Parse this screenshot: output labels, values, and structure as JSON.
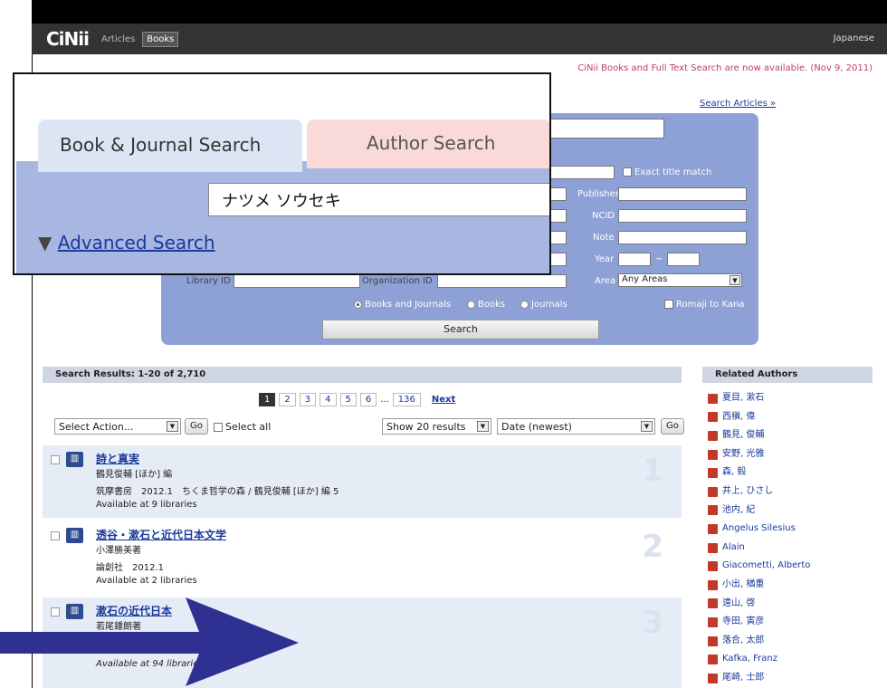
{
  "header": {
    "logo": "CiNii",
    "nav_articles": "Articles",
    "nav_books": "Books",
    "language": "Japanese"
  },
  "notice": "CiNii Books and Full Text Search are now available. (Nov 9, 2011)",
  "search_articles_link": "Search Articles »",
  "overlay": {
    "tab_book": "Book & Journal Search",
    "tab_author": "Author Search",
    "query_value": "ナツメ ソウセキ",
    "advanced_arrow": "▼",
    "advanced_label": "Advanced Search"
  },
  "form": {
    "exact_title": "Exact title match",
    "publisher": "Publisher",
    "ncid": "NCID",
    "note": "Note",
    "year": "Year",
    "year_sep": "~",
    "library_id": "Library ID",
    "organization_id": "Organization ID",
    "area": "Area",
    "area_value": "Any Areas",
    "radio_both": "Books and Journals",
    "radio_books": "Books",
    "radio_journals": "Journals",
    "romaji": "Romaji to Kana",
    "search_button": "Search"
  },
  "results": {
    "header": "Search Results: 1-20 of 2,710",
    "pages": [
      "1",
      "2",
      "3",
      "4",
      "5",
      "6"
    ],
    "ellipsis": "...",
    "last_page": "136",
    "next": "Next",
    "select_action": "Select Action...",
    "go": "Go",
    "select_all": "Select all",
    "show_results": "Show 20 results",
    "sort": "Date (newest)",
    "items": [
      {
        "title": "詩と真実",
        "author": "鶴見俊輔 [ほか] 編",
        "pub": "筑摩書房　2012.1　ちくま哲学の森 / 鶴見俊輔 [ほか] 編 5",
        "avail": "Available at 9 libraries",
        "num": "1"
      },
      {
        "title": "透谷・漱石と近代日本文学",
        "author": "小澤勝美著",
        "pub": "論創社　2012.1",
        "avail": "Available at 2 libraries",
        "num": "2"
      },
      {
        "title": "漱石の近代日本",
        "author": "若尾鍾朗著",
        "pub": "",
        "avail": "Available at 94 libraries",
        "num": "3"
      }
    ]
  },
  "related": {
    "header": "Related Authors",
    "authors": [
      "夏目, 漱石",
      "西槇, 偉",
      "鶴見, 俊輔",
      "安野, 光雅",
      "森, 毅",
      "井上, ひさし",
      "池内, 紀",
      "Angelus Silesius",
      "Alain",
      "Giacometti, Alberto",
      "小出, 楢重",
      "遠山, 啓",
      "寺田, 寅彦",
      "落合, 太郎",
      "Kafka, Franz",
      "尾崎, 士郎"
    ]
  },
  "colors": {
    "accent": "#8ea1d6",
    "nav": "#333333",
    "link": "#1a3a9c",
    "arrow": "#2e3192"
  }
}
